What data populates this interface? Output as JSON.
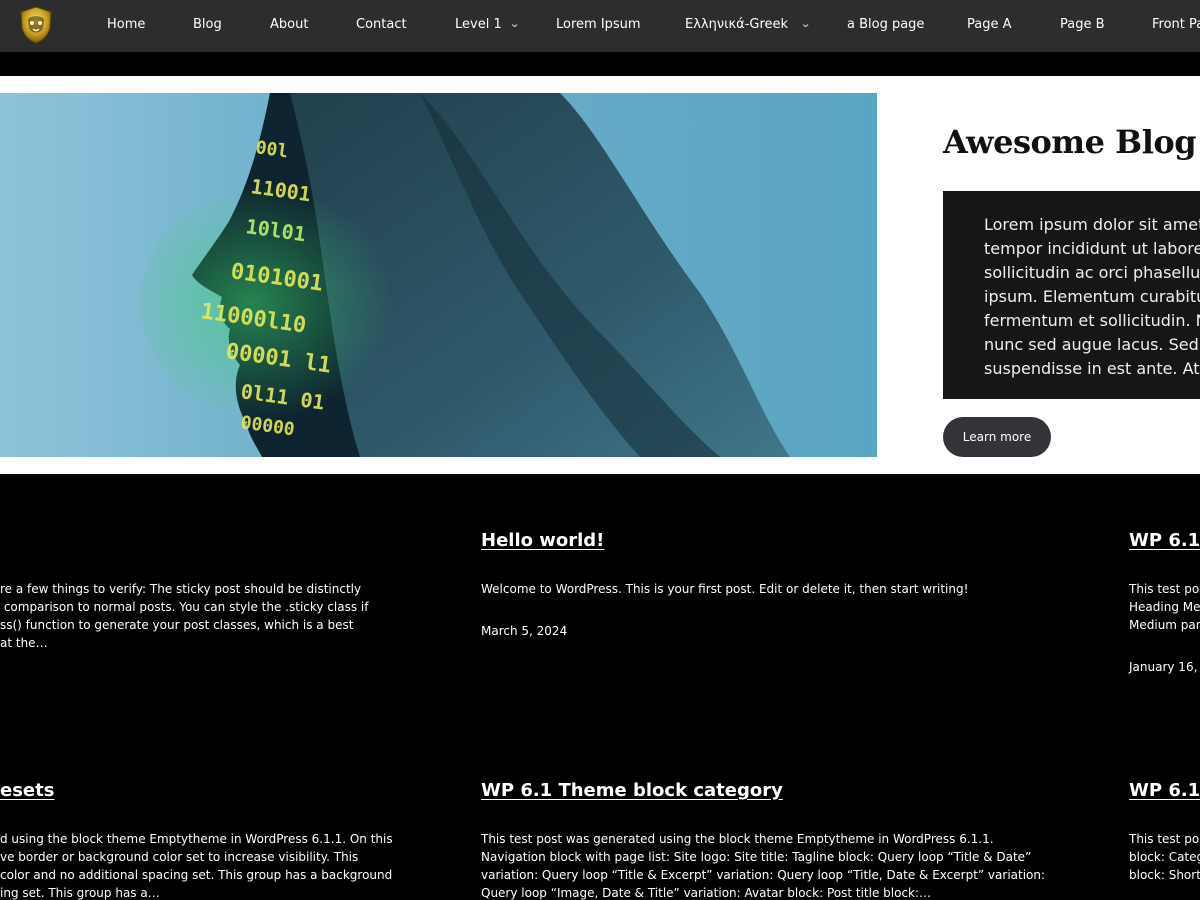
{
  "nav": {
    "items": [
      "Home",
      "Blog",
      "About",
      "Contact",
      "Level 1",
      "Lorem Ipsum",
      "Ελληνικά-Greek",
      "a Blog page",
      "Page A",
      "Page B",
      "Front Pa"
    ]
  },
  "hero": {
    "title": "Awesome Blog",
    "text": "Lorem ipsum dolor sit amet\ntempor incididunt ut labore\nsollicitudin ac orci phasellus\nipsum. Elementum curabitu\nfermentum et sollicitudin. N\nnunc sed augue lacus. Sed\nsuspendisse in est ante. At",
    "button": "Learn more"
  },
  "posts": [
    {
      "title": "",
      "excerpt": "re a few things to verify: The sticky post should be distinctly\n comparison to normal posts. You can style the .sticky class if\nss() function to generate your post classes, which is a best\nat the…",
      "date": ""
    },
    {
      "title": "Hello world!",
      "excerpt": "Welcome to WordPress. This is your first post. Edit or delete it, then start writing!",
      "date": "March 5, 2024"
    },
    {
      "title": "WP 6.1 F",
      "excerpt": "This test po\nHeading Me\nMedium par",
      "date": "January 16,"
    },
    {
      "title": "esets",
      "excerpt": "d using the block theme Emptytheme in WordPress 6.1.1. On this\nve border or background color set to increase visibility. This\ncolor and no additional spacing set. This group has a background\ning set. This group has a…",
      "date": ""
    },
    {
      "title": "WP 6.1 Theme block category",
      "excerpt": "This test post was generated using the block theme Emptytheme in WordPress 6.1.1.\nNavigation block with page list: Site logo: Site title: Tagline block: Query loop “Title & Date”\nvariation: Query loop “Title & Excerpt” variation: Query loop “Title, Date & Excerpt” variation:\nQuery loop “Image, Date & Title” variation: Avatar block: Post title block:…",
      "date": ""
    },
    {
      "title": "WP 6.1 W",
      "excerpt": "This test po\nblock: Categ\nblock: Short",
      "date": ""
    }
  ]
}
